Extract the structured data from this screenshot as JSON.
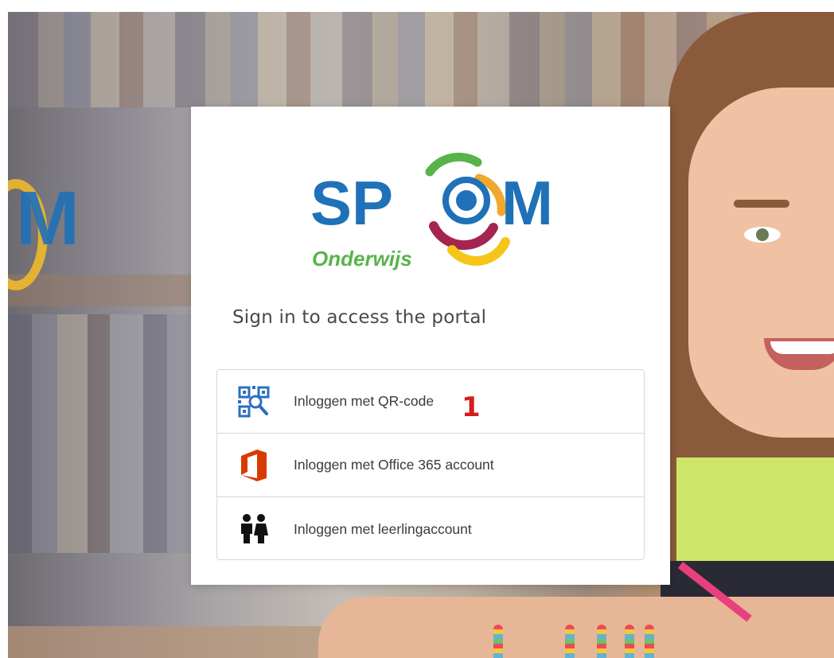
{
  "card": {
    "subtitle": "Sign in to access the portal",
    "logo": {
      "brand": "SPOM",
      "tagline": "Onderwijs"
    }
  },
  "options": [
    {
      "label": "Inloggen met QR-code",
      "icon": "qr-code-icon"
    },
    {
      "label": "Inloggen met Office 365 account",
      "icon": "office365-icon"
    },
    {
      "label": "Inloggen met leerlingaccount",
      "icon": "students-icon"
    }
  ],
  "annotation": {
    "marker": "1"
  },
  "background": {
    "logo_fragment": "M"
  },
  "colors": {
    "brand_blue": "#1f71b8",
    "brand_green": "#58b44a",
    "brand_orange": "#f0a92c",
    "brand_maroon": "#a4254f",
    "brand_yellow": "#f5c518",
    "office_red": "#d83b01",
    "qr_blue": "#2a6fc1",
    "marker_red": "#d81c1c"
  }
}
